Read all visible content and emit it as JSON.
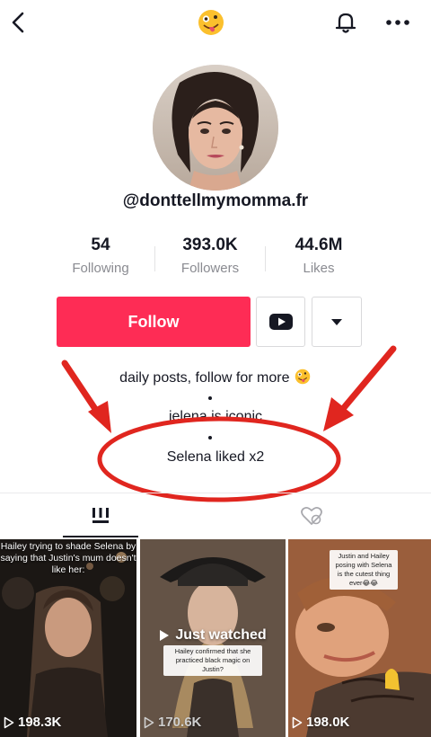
{
  "header": {
    "title_emoji": "zany-face-emoji",
    "icons": [
      "back-chevron-icon",
      "bell-icon",
      "more-dots-icon"
    ]
  },
  "profile": {
    "username": "@donttellmymomma.fr",
    "stats": [
      {
        "value": "54",
        "label": "Following"
      },
      {
        "value": "393.0K",
        "label": "Followers"
      },
      {
        "value": "44.6M",
        "label": "Likes"
      }
    ]
  },
  "actions": {
    "follow_label": "Follow",
    "youtube_icon": "youtube-icon",
    "dropdown_icon": "caret-down-icon"
  },
  "bio": {
    "line1": "daily posts, follow for more",
    "line1_emoji": "zany-face-emoji",
    "line2": "jelena is iconic",
    "line3": "Selena liked x2"
  },
  "annotations": {
    "arrow_color": "#e0261f",
    "circle_color": "#e0261f"
  },
  "tabs": [
    {
      "icon": "grid-bars-icon",
      "selected": true
    },
    {
      "icon": "liked-heart-hidden-icon",
      "selected": false
    }
  ],
  "videos": [
    {
      "views": "198.3K",
      "caption": "Hailey trying to shade Selena by saying that Justin's mum doesn't like her:"
    },
    {
      "views": "170.6K",
      "overlay": "Just watched",
      "caption": "Hailey confirmed that she practiced black magic on Justin?"
    },
    {
      "views": "198.0K",
      "caption": "Justin and Hailey posing with Selena is the cutest thing ever😂😂"
    }
  ],
  "colors": {
    "primary": "#fe2c55",
    "text": "#161823",
    "secondary_text": "#8a8b91"
  }
}
